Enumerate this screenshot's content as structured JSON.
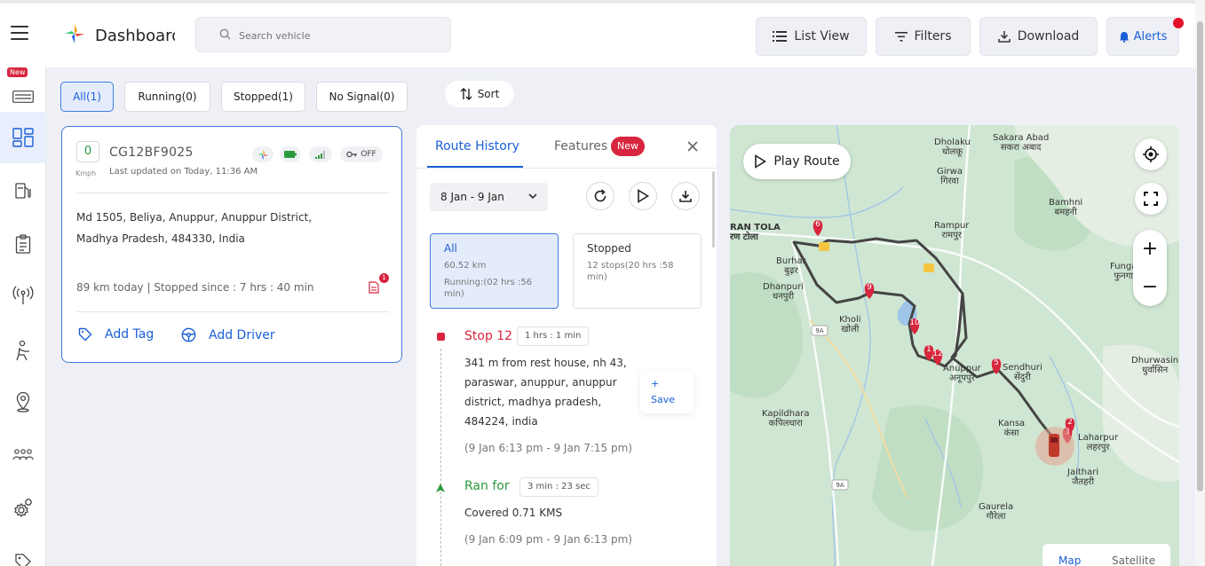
{
  "header": {
    "title": "Dashboard",
    "search_placeholder": "Search vehicle",
    "list_view_label": "List View",
    "filters_label": "Filters",
    "download_label": "Download",
    "alerts_label": "Alerts"
  },
  "sidenav": {
    "new_badge": "New",
    "items": [
      "card-icon",
      "dashboard-icon",
      "fuel-icon",
      "report-icon",
      "signal-icon",
      "driver-icon",
      "location-icon",
      "group-icon",
      "settings-icon",
      "tag-icon"
    ]
  },
  "filter_tabs": [
    {
      "label": "All(1)",
      "active": true
    },
    {
      "label": "Running(0)",
      "active": false
    },
    {
      "label": "Stopped(1)",
      "active": false
    },
    {
      "label": "No Signal(0)",
      "active": false
    }
  ],
  "sort_label": "Sort",
  "vehicle": {
    "speed": "0",
    "speed_unit": "Kmph",
    "plate": "CG12BF9025",
    "last_updated": "Last updated on Today, 11:36 AM",
    "ignition": "OFF",
    "address_line1": "Md 1505, Beliya, Anuppur, Anuppur District,",
    "address_line2": "Madhya Pradesh, 484330, India",
    "status": "89 km today | Stopped since : 7 hrs : 40 min",
    "doc_count": "1",
    "add_tag": "Add Tag",
    "add_driver": "Add Driver"
  },
  "route_panel": {
    "tab_route": "Route History",
    "tab_features": "Features",
    "features_badge": "New",
    "date_range": "8 Jan - 9 Jan",
    "summary_all": {
      "title": "All",
      "distance": "60.52 km",
      "running_1": "Running:(02 hrs :56",
      "running_2": "min)"
    },
    "summary_stopped": {
      "title": "Stopped",
      "line1": "12 stops(20 hrs :58",
      "line2": "min)"
    },
    "timeline": {
      "stop_title": "Stop 12",
      "stop_duration": "1 hrs : 1 min",
      "stop_addr_1": "341 m from rest house, nh 43,",
      "stop_addr_2": "paraswar, anuppur, anuppur",
      "stop_addr_3": "district, madhya pradesh,",
      "stop_addr_4": "484224, india",
      "stop_time": "(9 Jan 6:13 pm - 9 Jan 7:15 pm)",
      "save_plus": "+",
      "save_label": "Save",
      "run_title": "Ran for",
      "run_duration": "3 min : 23 sec",
      "run_covered": "Covered 0.71 KMS",
      "run_time": "(9 Jan 6:09 pm - 9 Jan 6:13 pm)"
    }
  },
  "map": {
    "play_route": "Play Route",
    "map_label": "Map",
    "satellite_label": "Satellite",
    "zoom_in": "+",
    "zoom_out": "−",
    "places": [
      {
        "en": "Dholaku",
        "hi": "धोलकू"
      },
      {
        "en": "Sakara Abad",
        "hi": "सकरा अबाद"
      },
      {
        "en": "Girwa",
        "hi": "गिरवा"
      },
      {
        "en": "Bamhni",
        "hi": "बमहनी"
      },
      {
        "en": "RAN TOLA",
        "hi": "रण टोला"
      },
      {
        "en": "Rampur",
        "hi": "रामपुर"
      },
      {
        "en": "Burhar",
        "hi": "बुढ़र"
      },
      {
        "en": "Funga",
        "hi": "फुनगा"
      },
      {
        "en": "Dhanpuri",
        "hi": "धनपुरी"
      },
      {
        "en": "Kholi",
        "hi": "खोली"
      },
      {
        "en": "Anuppur",
        "hi": "अनूपपुर"
      },
      {
        "en": "Sendhuri",
        "hi": "सेंदुरी"
      },
      {
        "en": "Dhurwasin",
        "hi": "धुर्वासिन"
      },
      {
        "en": "Kapildhara",
        "hi": "कपिलधारा"
      },
      {
        "en": "Kansa",
        "hi": "कंसा"
      },
      {
        "en": "Laharpur",
        "hi": "लहरपुर"
      },
      {
        "en": "Jaithari",
        "hi": "जैतहरी"
      },
      {
        "en": "Gaurela",
        "hi": "गौरेला"
      }
    ],
    "shields": [
      "9A",
      "9A"
    ],
    "pins": [
      "6",
      "9",
      "10",
      "1",
      "12",
      "5",
      "2",
      "3"
    ],
    "colors": {
      "route": "#444444",
      "pin": "#d7263d",
      "water": "#9fc5e8",
      "land": "#cfe6d2"
    }
  }
}
